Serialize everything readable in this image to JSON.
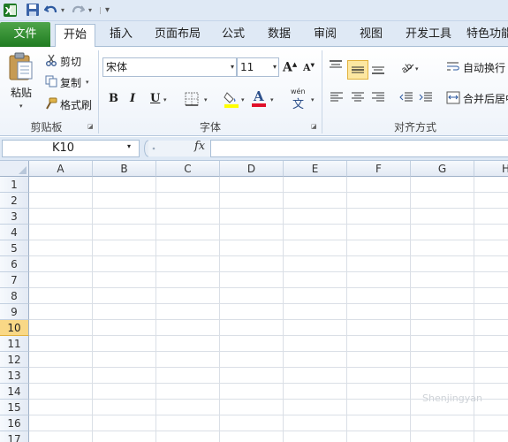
{
  "quick_access": {
    "icons": [
      "excel-logo-icon",
      "save-icon",
      "undo-icon",
      "redo-icon",
      "customize-qat-icon"
    ]
  },
  "tabs": {
    "file": "文件",
    "items": [
      "开始",
      "插入",
      "页面布局",
      "公式",
      "数据",
      "审阅",
      "视图",
      "开发工具",
      "特色功能"
    ],
    "active": "开始"
  },
  "ribbon": {
    "clipboard": {
      "label": "剪贴板",
      "paste": "粘贴",
      "cut": "剪切",
      "copy": "复制",
      "format_painter": "格式刷"
    },
    "font": {
      "label": "字体",
      "font_name": "宋体",
      "font_size": "11",
      "bold": "B",
      "italic": "I",
      "underline": "U",
      "grow": "A",
      "shrink": "A",
      "font_color_letter": "A",
      "wen": "wén",
      "wen_char": "文"
    },
    "alignment": {
      "label": "对齐方式",
      "wrap_text": "自动换行",
      "merge_center": "合并后居中"
    }
  },
  "formula_bar": {
    "name_box": "K10",
    "fx": "fx",
    "formula": ""
  },
  "sheet": {
    "columns": [
      "A",
      "B",
      "C",
      "D",
      "E",
      "F",
      "G",
      "H"
    ],
    "rows": [
      "1",
      "2",
      "3",
      "4",
      "5",
      "6",
      "7",
      "8",
      "9",
      "10",
      "11",
      "12",
      "13",
      "14",
      "15",
      "16",
      "17"
    ],
    "selected_row": "10"
  },
  "watermark": "Shenjingyan"
}
